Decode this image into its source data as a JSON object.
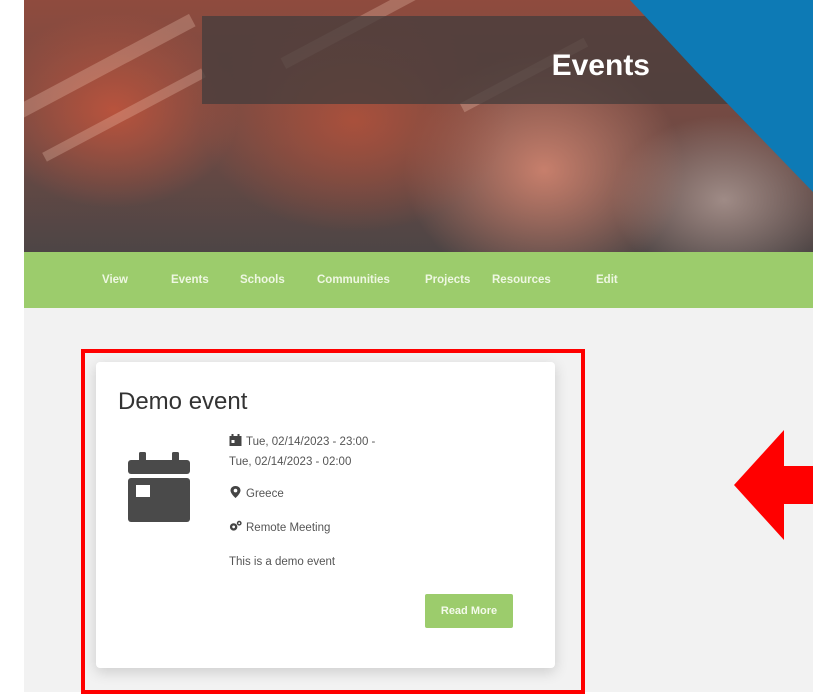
{
  "header": {
    "title": "Events"
  },
  "nav": {
    "items": [
      "View",
      "Events",
      "Schools",
      "Communities",
      "Projects",
      "Resources",
      "Edit"
    ]
  },
  "event": {
    "title": "Demo event",
    "date_line1": "Tue, 02/14/2023 - 23:00 -",
    "date_line2": "Tue, 02/14/2023 - 02:00",
    "location": "Greece",
    "type": "Remote Meeting",
    "description": "This is a demo event",
    "read_more": "Read More"
  },
  "icons": {
    "date": "calendar-icon",
    "location": "map-marker-icon",
    "type": "cogs-icon",
    "card": "calendar-icon"
  },
  "colors": {
    "accent_green": "#9ccc6c",
    "corner_blue": "#0d7ab5",
    "highlight_red": "#ff0000",
    "icon_dark": "#4a4a4a"
  }
}
